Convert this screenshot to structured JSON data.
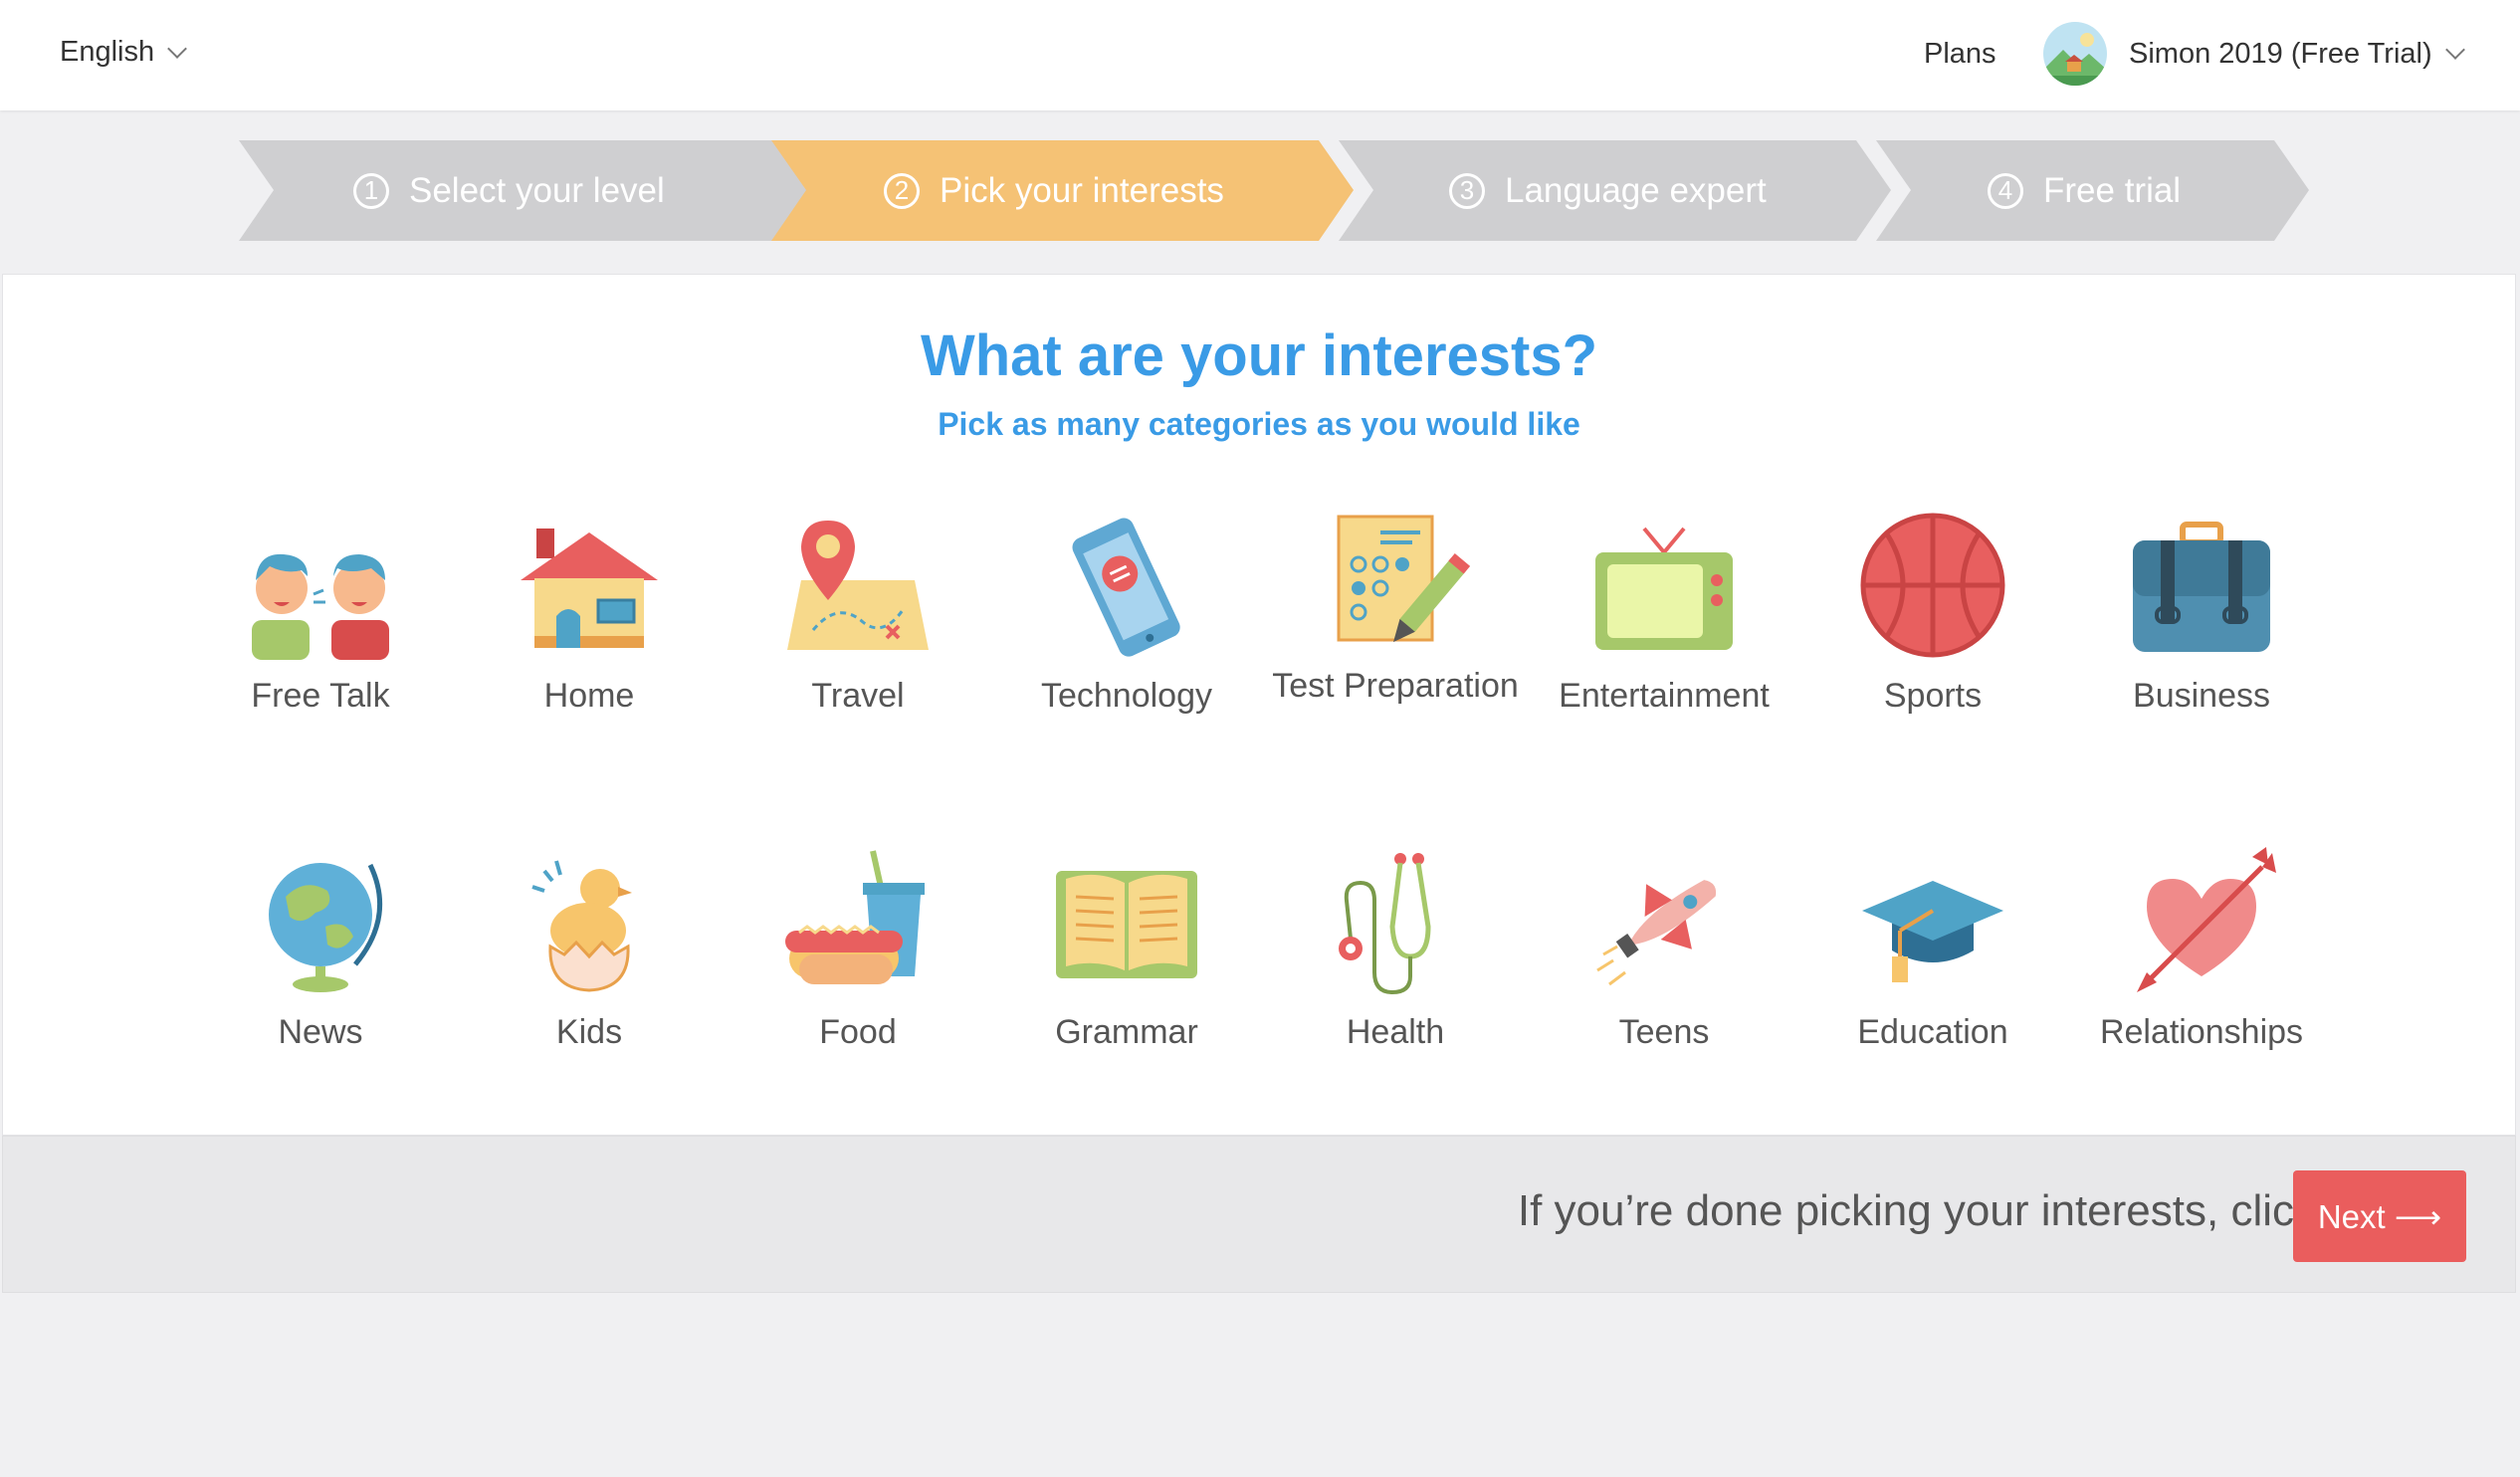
{
  "image_id_text": "0001-036994",
  "header": {
    "language": "English",
    "plans_label": "Plans",
    "user_name": "Simon 2019 (Free Trial)"
  },
  "steps": [
    {
      "number": "1",
      "label": "Select your level",
      "active": false
    },
    {
      "number": "2",
      "label": "Pick your interests",
      "active": true
    },
    {
      "number": "3",
      "label": "Language expert",
      "active": false
    },
    {
      "number": "4",
      "label": "Free trial",
      "active": false
    }
  ],
  "colors": {
    "active_step": "#f5c275",
    "inactive_step": "#cfcfd1",
    "heading": "#3a9be6",
    "next_button": "#ea5d5d"
  },
  "main": {
    "title": "What are your interests?",
    "subtitle": "Pick as many categories as you would like",
    "categories": [
      {
        "label": "Free Talk",
        "icon": "people-talking-icon"
      },
      {
        "label": "Home",
        "icon": "house-icon"
      },
      {
        "label": "Travel",
        "icon": "map-pin-icon"
      },
      {
        "label": "Technology",
        "icon": "smartphone-icon"
      },
      {
        "label": "Test Preparation",
        "icon": "test-sheet-pencil-icon"
      },
      {
        "label": "Entertainment",
        "icon": "tv-icon"
      },
      {
        "label": "Sports",
        "icon": "basketball-icon"
      },
      {
        "label": "Business",
        "icon": "briefcase-icon"
      },
      {
        "label": "News",
        "icon": "globe-icon"
      },
      {
        "label": "Kids",
        "icon": "chick-icon"
      },
      {
        "label": "Food",
        "icon": "hotdog-drink-icon"
      },
      {
        "label": "Grammar",
        "icon": "open-book-icon"
      },
      {
        "label": "Health",
        "icon": "stethoscope-icon"
      },
      {
        "label": "Teens",
        "icon": "rocket-icon"
      },
      {
        "label": "Education",
        "icon": "graduation-cap-icon"
      },
      {
        "label": "Relationships",
        "icon": "heart-arrow-icon"
      }
    ]
  },
  "footer": {
    "prompt": "If you’re done picking your interests, click",
    "next_label": "Next ⟶"
  }
}
